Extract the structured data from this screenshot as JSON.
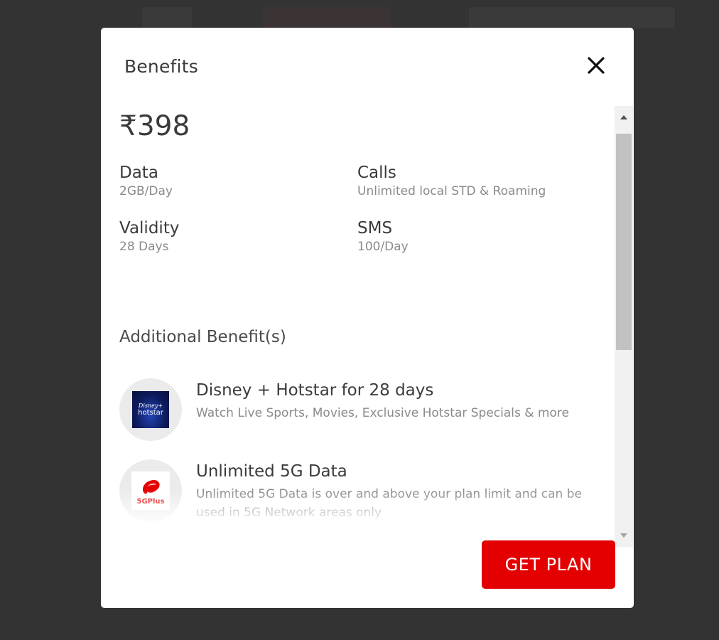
{
  "modal": {
    "title": "Benefits",
    "close_label": "×",
    "price": "₹398",
    "specs": [
      {
        "label": "Data",
        "value": "2GB/Day"
      },
      {
        "label": "Calls",
        "value": "Unlimited local STD & Roaming"
      },
      {
        "label": "Validity",
        "value": "28 Days"
      },
      {
        "label": "SMS",
        "value": "100/Day"
      }
    ],
    "additional_title": "Additional Benefit(s)",
    "benefits": [
      {
        "icon": "disney-hotstar-logo",
        "logo_line1": "Disney+",
        "logo_line2": "hotstar",
        "title": "Disney + Hotstar for 28 days",
        "description": "Watch Live Sports, Movies, Exclusive Hotstar Specials & more"
      },
      {
        "icon": "airtel-5gplus-logo",
        "logo_text": "5GPlus",
        "title": "Unlimited 5G Data",
        "description": "Unlimited 5G Data is over and above your plan limit and can be used in 5G Network areas only"
      }
    ],
    "cta_label": "GET PLAN",
    "scroll_position": 0.0
  },
  "colors": {
    "brand_red": "#e40000",
    "backdrop": "#333333",
    "text_primary": "#3b3b3b",
    "text_secondary": "#8a8a8a"
  }
}
